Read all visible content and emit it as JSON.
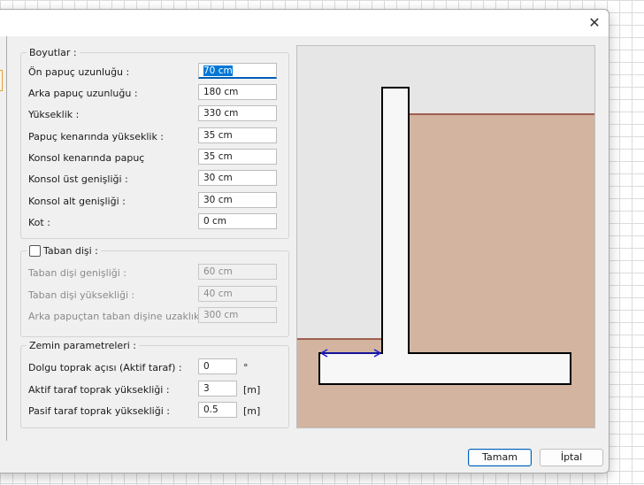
{
  "dialog": {
    "close_icon": "close-icon",
    "ok_label": "Tamam",
    "cancel_label": "İptal"
  },
  "boyutlar": {
    "title": "Boyutlar :",
    "fields": [
      {
        "label": "Ön papuç uzunluğu :",
        "value": "70 cm"
      },
      {
        "label": "Arka papuç uzunluğu :",
        "value": "180 cm"
      },
      {
        "label": "Yükseklik :",
        "value": "330 cm"
      },
      {
        "label": "Papuç kenarında yükseklik :",
        "value": "35 cm"
      },
      {
        "label": "Konsol kenarında papuç",
        "value": "35 cm"
      },
      {
        "label": "Konsol üst genişliği :",
        "value": "30 cm"
      },
      {
        "label": "Konsol alt genişliği :",
        "value": "30 cm"
      },
      {
        "label": "Kot :",
        "value": "0 cm"
      }
    ]
  },
  "taban_disi": {
    "title": "Taban dişi :",
    "checked": false,
    "fields": [
      {
        "label": "Taban dişi genişliği :",
        "value": "60 cm"
      },
      {
        "label": "Taban dişi yüksekliği :",
        "value": "40 cm"
      },
      {
        "label": "Arka papuçtan taban dişine uzaklık :",
        "value": "300 cm"
      }
    ]
  },
  "zemin": {
    "title": "Zemin parametreleri :",
    "fields": [
      {
        "label": "Dolgu toprak açısı (Aktif taraf) :",
        "value": "0",
        "unit": "°"
      },
      {
        "label": "Aktif taraf toprak yüksekliği :",
        "value": "3",
        "unit": "[m]"
      },
      {
        "label": "Pasif taraf toprak yüksekliği :",
        "value": "0.5",
        "unit": "[m]"
      }
    ]
  },
  "preview": {
    "background_color": "#e6e6e6",
    "soil_color": "#d2b4a0",
    "soil_line_color": "#8b3a2a",
    "wall_fill": "#f7f7f7",
    "dimension_color": "#1a1acc"
  }
}
